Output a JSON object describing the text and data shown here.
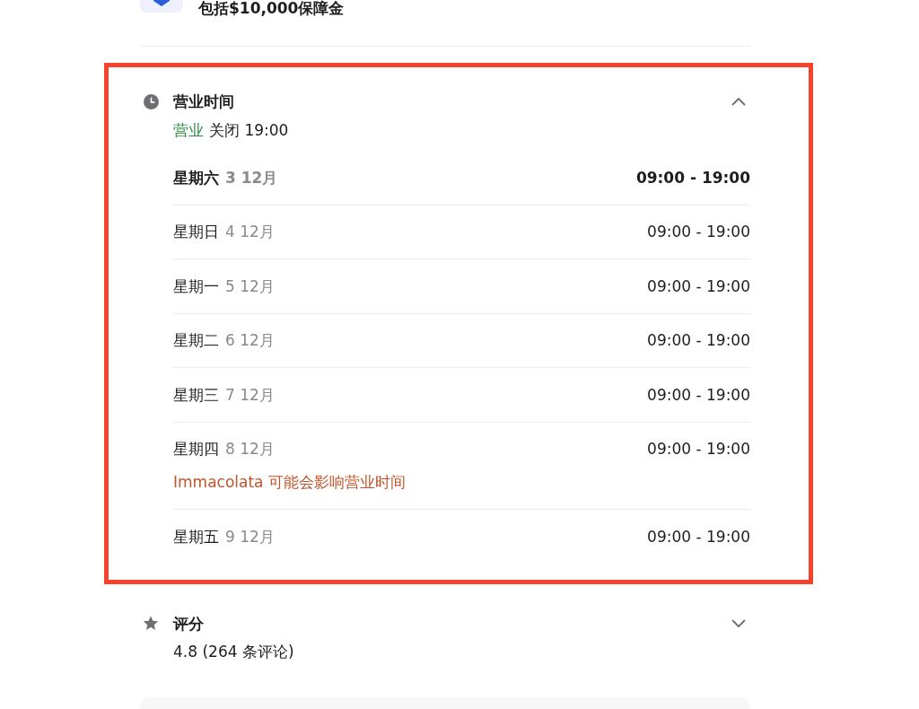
{
  "guarantee": {
    "text": "包括$10,000保障金"
  },
  "hours_section": {
    "title": "营业时间",
    "expanded": true,
    "highlighted": true,
    "status": {
      "label": "营业",
      "open": true,
      "detail": "关闭 19:00"
    },
    "days": [
      {
        "day": "星期六",
        "date": "3 12月",
        "hours": "09:00 - 19:00",
        "current": true
      },
      {
        "day": "星期日",
        "date": "4 12月",
        "hours": "09:00 - 19:00",
        "current": false
      },
      {
        "day": "星期一",
        "date": "5 12月",
        "hours": "09:00 - 19:00",
        "current": false
      },
      {
        "day": "星期二",
        "date": "6 12月",
        "hours": "09:00 - 19:00",
        "current": false
      },
      {
        "day": "星期三",
        "date": "7 12月",
        "hours": "09:00 - 19:00",
        "current": false
      },
      {
        "day": "星期四",
        "date": "8 12月",
        "hours": "09:00 - 19:00",
        "current": false,
        "note": "Immacolata 可能会影响营业时间"
      },
      {
        "day": "星期五",
        "date": "9 12月",
        "hours": "09:00 - 19:00",
        "current": false
      }
    ]
  },
  "rating_section": {
    "title": "评分",
    "expanded": false,
    "summary": "4.8 (264 条评论)"
  }
}
